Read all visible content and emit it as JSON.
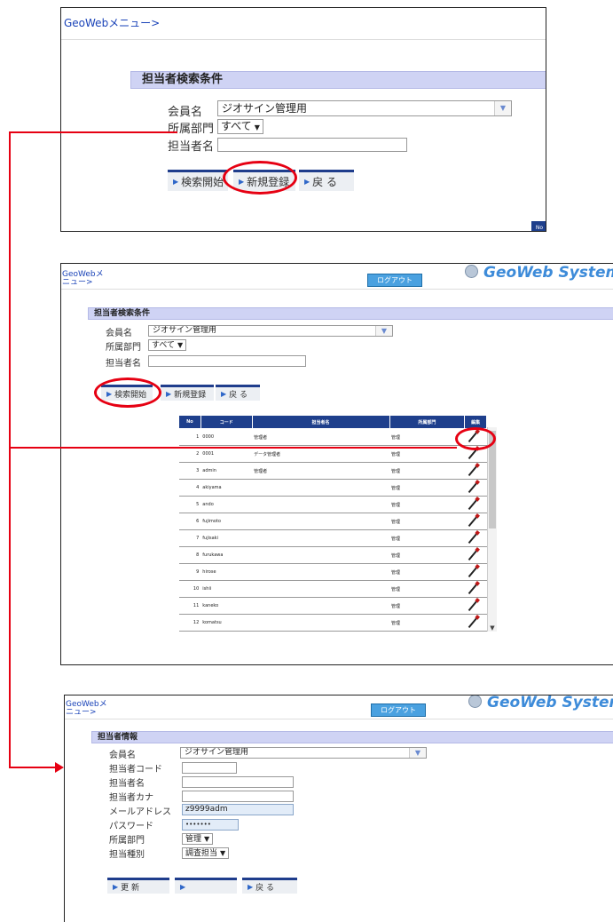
{
  "panel1": {
    "nav_link": "GeoWebメニュー>",
    "section_title": "担当者検索条件",
    "member_label": "会員名",
    "member_value": "ジオサイン管理用",
    "dept_label": "所属部門",
    "dept_value": "すべて",
    "staff_name_label": "担当者名",
    "staff_name_value": "",
    "search_button": "検索開始",
    "new_button": "新規登録",
    "back_button": "戻 る",
    "no_badge": "No"
  },
  "panel2": {
    "nav_link_line1": "GeoWebメ",
    "nav_link_line2": "ニュー>",
    "logout_button": "ログアウト",
    "logo_text": "GeoWeb System",
    "section_title": "担当者検索条件",
    "member_label": "会員名",
    "member_value": "ジオサイン管理用",
    "dept_label": "所属部門",
    "dept_value": "すべて",
    "staff_name_label": "担当者名",
    "search_button": "検索開始",
    "new_button": "新規登録",
    "back_button": "戻 る",
    "table": {
      "headers": [
        "No",
        "コード",
        "担当者名",
        "所属部門",
        "編集"
      ],
      "rows": [
        {
          "no": "1",
          "code": "0000",
          "name": "管理者",
          "dept": "管理"
        },
        {
          "no": "2",
          "code": "0001",
          "name": "データ管理者",
          "dept": "管理"
        },
        {
          "no": "3",
          "code": "admin",
          "name": "管理者",
          "dept": "管理"
        },
        {
          "no": "4",
          "code": "akiyama",
          "name": "",
          "dept": "管理"
        },
        {
          "no": "5",
          "code": "ando",
          "name": "",
          "dept": "管理"
        },
        {
          "no": "6",
          "code": "fujimoto",
          "name": "",
          "dept": "管理"
        },
        {
          "no": "7",
          "code": "fujisaki",
          "name": "",
          "dept": "管理"
        },
        {
          "no": "8",
          "code": "furukawa",
          "name": "",
          "dept": "管理"
        },
        {
          "no": "9",
          "code": "hirose",
          "name": "",
          "dept": "管理"
        },
        {
          "no": "10",
          "code": "ishii",
          "name": "",
          "dept": "管理"
        },
        {
          "no": "11",
          "code": "kaneko",
          "name": "",
          "dept": "管理"
        },
        {
          "no": "12",
          "code": "komatsu",
          "name": "",
          "dept": "管理"
        }
      ]
    }
  },
  "panel3": {
    "nav_link_line1": "GeoWebメ",
    "nav_link_line2": "ニュー>",
    "logout_button": "ログアウト",
    "logo_text": "GeoWeb System",
    "section_title": "担当者情報",
    "member_label": "会員名",
    "member_value": "ジオサイン管理用",
    "code_label": "担当者コード",
    "name_label": "担当者名",
    "kana_label": "担当者カナ",
    "email_label": "メールアドレス",
    "email_value": "z9999adm",
    "password_label": "パスワード",
    "password_value": "•••••••",
    "dept_label": "所属部門",
    "dept_value": "管理",
    "type_label": "担当種別",
    "type_value": "調査担当",
    "update_button": "更 新",
    "disabled_button": "",
    "back_button": "戻 る"
  },
  "colors": {
    "accent_red": "#e60012",
    "header_bar": "#cfd3f4",
    "table_header": "#1e3f8c",
    "link": "#1a43b8"
  }
}
